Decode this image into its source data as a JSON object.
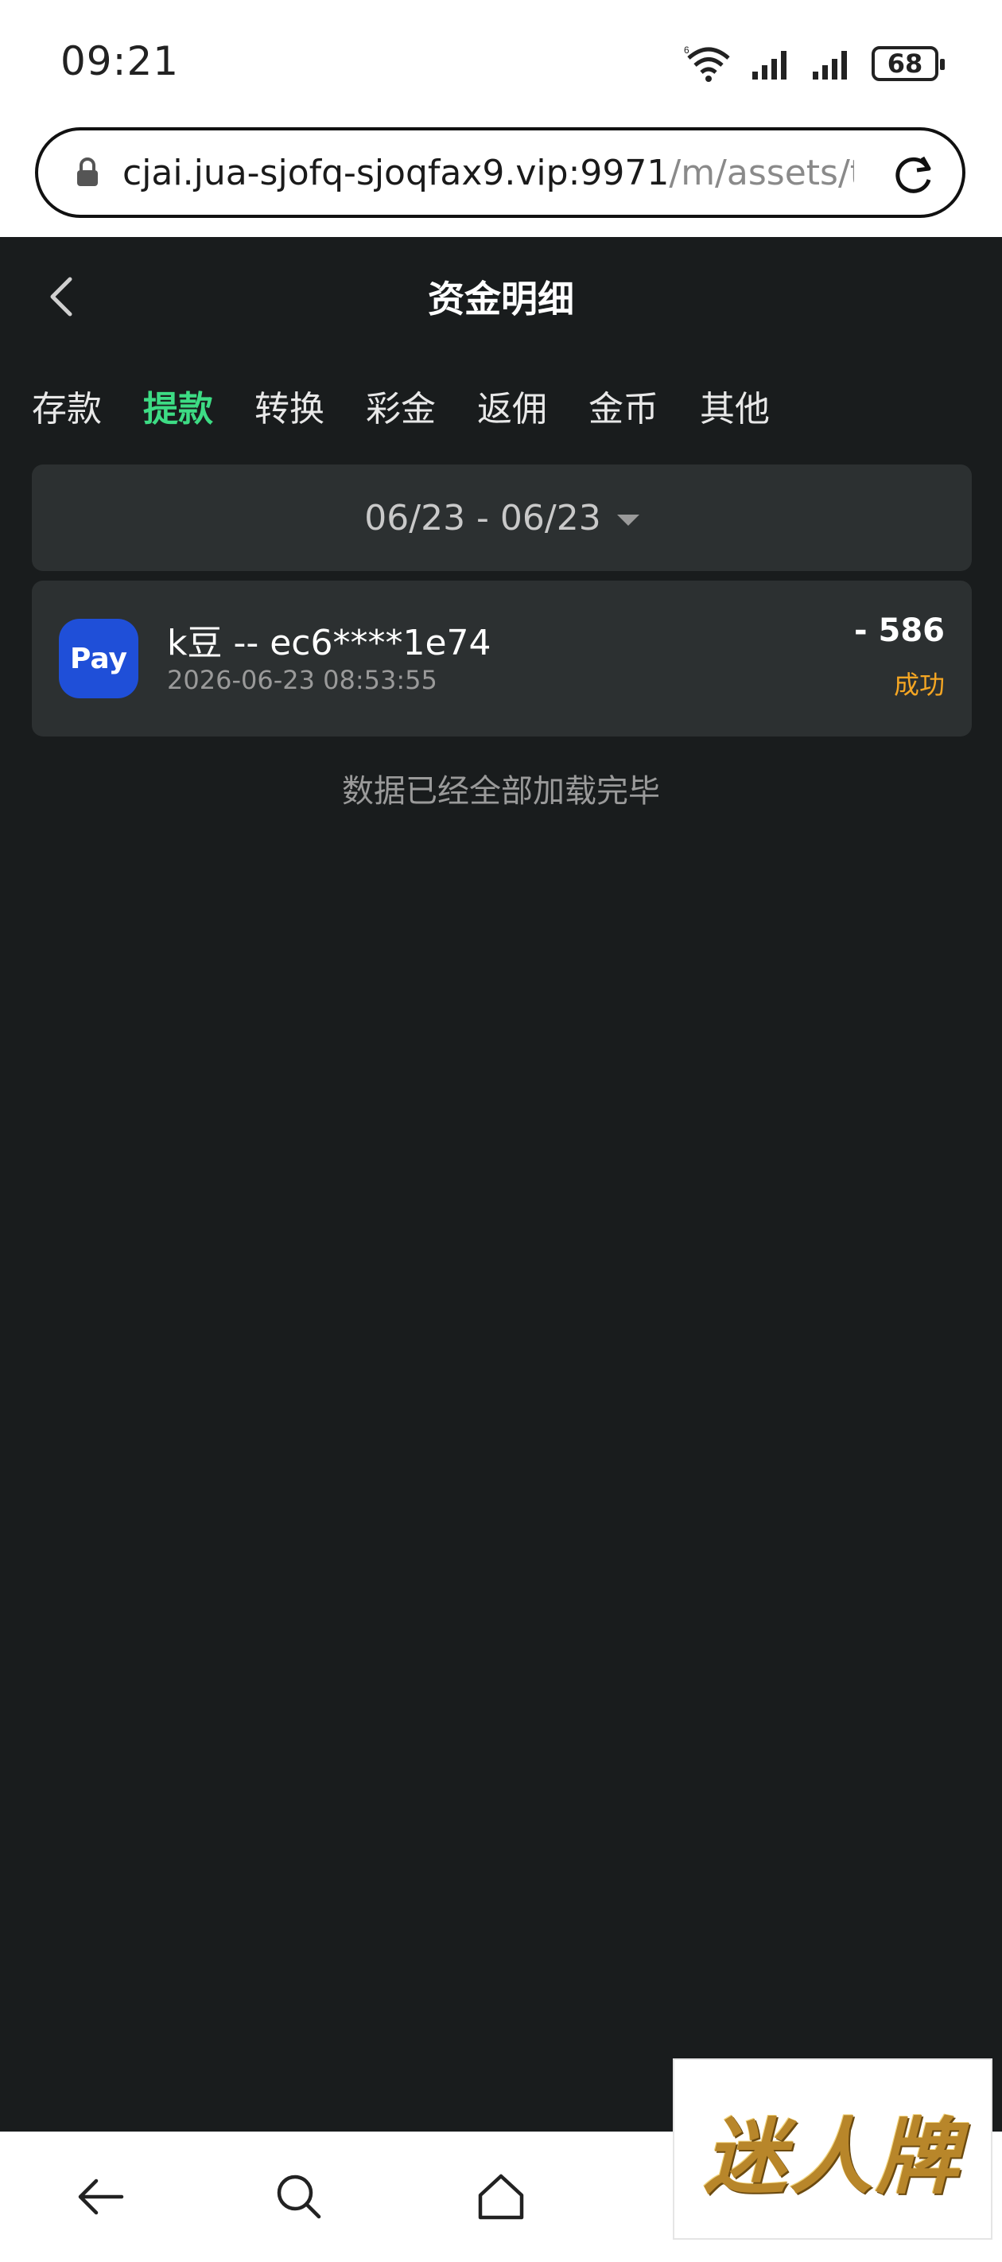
{
  "status_bar": {
    "time": "09:21",
    "battery": "68"
  },
  "url_bar": {
    "host": "cjai.jua-sjofq-sjoqfax9.vip:9971",
    "path": "/m/assets/tra"
  },
  "header": {
    "title": "资金明细"
  },
  "tabs": [
    {
      "label": "存款",
      "active": false
    },
    {
      "label": "提款",
      "active": true
    },
    {
      "label": "转换",
      "active": false
    },
    {
      "label": "彩金",
      "active": false
    },
    {
      "label": "返佣",
      "active": false
    },
    {
      "label": "金币",
      "active": false
    },
    {
      "label": "其他",
      "active": false
    }
  ],
  "date_filter": {
    "range": "06/23 - 06/23"
  },
  "transactions": [
    {
      "logo_text": "Pay",
      "title": "k豆 -- ec6****1e74",
      "time": "2026-06-23 08:53:55",
      "amount": "- 586",
      "status": "成功"
    }
  ],
  "end_note": "数据已经全部加载完毕",
  "watermark": "迷人牌",
  "colors": {
    "background": "#191c1d",
    "card": "#2c3031",
    "active_tab": "#3ddc84",
    "status_success": "#f5a623",
    "pay_logo": "#1f4fd8"
  }
}
